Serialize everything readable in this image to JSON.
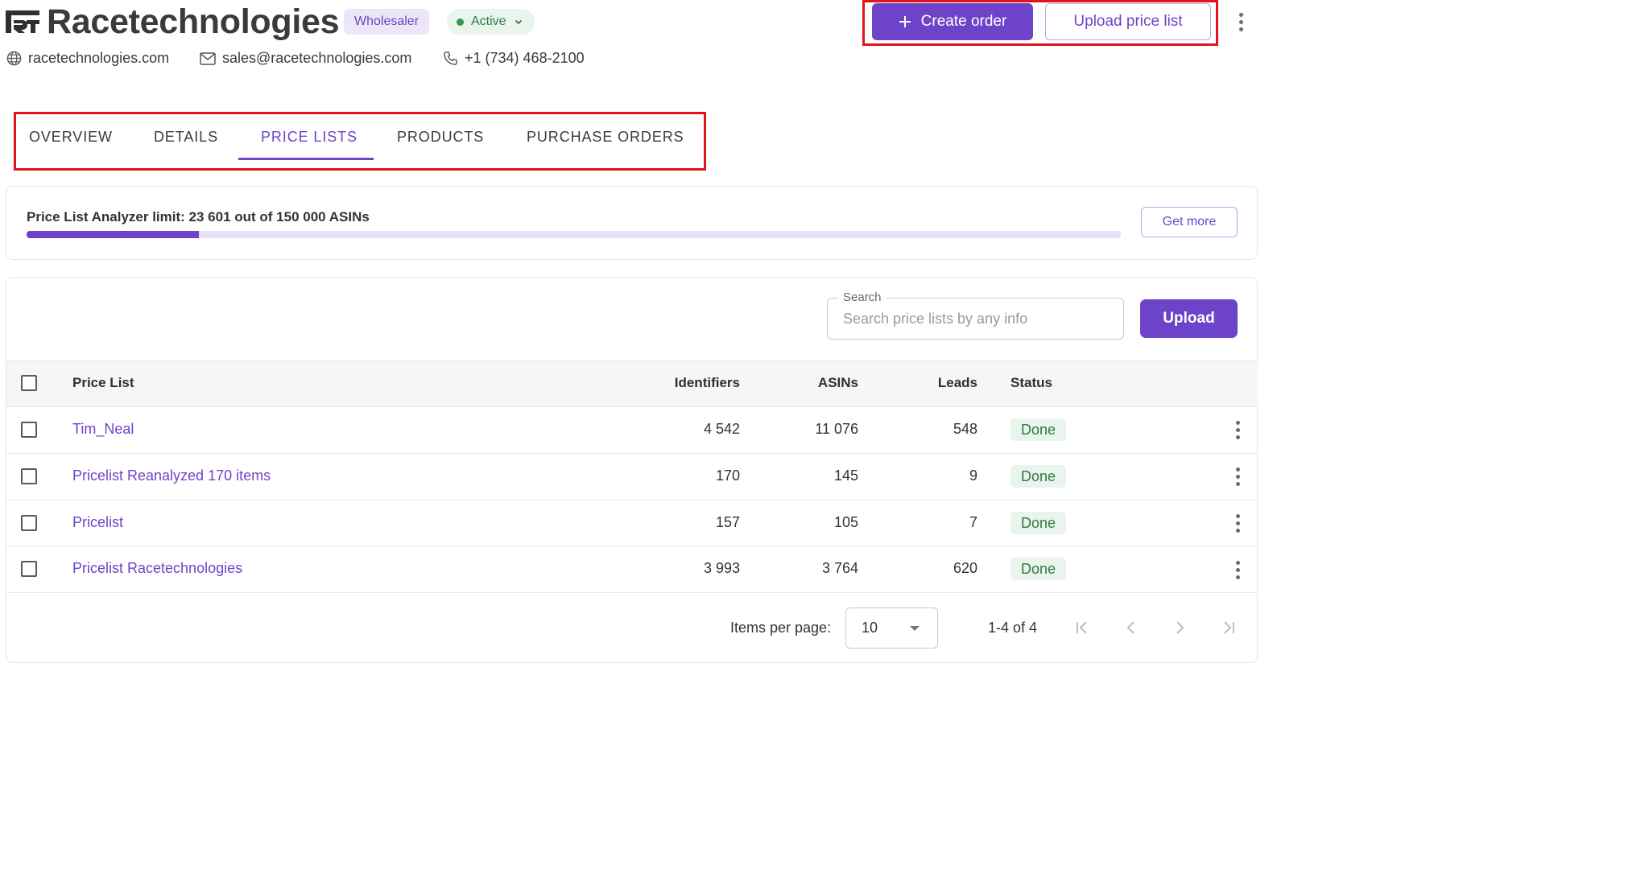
{
  "header": {
    "company": "Racetechnologies",
    "type_badge": "Wholesaler",
    "status_badge": "Active",
    "website": "racetechnologies.com",
    "email": "sales@racetechnologies.com",
    "phone": "+1 (734) 468-2100",
    "create_order_label": "Create order",
    "upload_price_list_label": "Upload price list"
  },
  "tabs": [
    {
      "label": "OVERVIEW",
      "active": false
    },
    {
      "label": "DETAILS",
      "active": false
    },
    {
      "label": "PRICE LISTS",
      "active": true
    },
    {
      "label": "PRODUCTS",
      "active": false
    },
    {
      "label": "PURCHASE ORDERS",
      "active": false
    }
  ],
  "limit": {
    "text": "Price List Analyzer limit: 23 601 out of 150 000 ASINs",
    "used": 23601,
    "total": 150000,
    "get_more_label": "Get more"
  },
  "search": {
    "label": "Search",
    "placeholder": "Search price lists by any info",
    "value": ""
  },
  "upload_label": "Upload",
  "table": {
    "columns": [
      "Price List",
      "Identifiers",
      "ASINs",
      "Leads",
      "Status"
    ],
    "rows": [
      {
        "name": "Tim_Neal",
        "identifiers": "4 542",
        "asins": "11 076",
        "leads": "548",
        "status": "Done"
      },
      {
        "name": "Pricelist Reanalyzed 170 items",
        "identifiers": "170",
        "asins": "145",
        "leads": "9",
        "status": "Done"
      },
      {
        "name": "Pricelist",
        "identifiers": "157",
        "asins": "105",
        "leads": "7",
        "status": "Done"
      },
      {
        "name": "Pricelist Racetechnologies",
        "identifiers": "3 993",
        "asins": "3 764",
        "leads": "620",
        "status": "Done"
      }
    ]
  },
  "pagination": {
    "items_per_page_label": "Items per page:",
    "items_per_page": "10",
    "range": "1-4 of 4"
  },
  "colors": {
    "accent": "#6d44c9",
    "success": "#2f7a45",
    "highlight": "#e0141b"
  }
}
